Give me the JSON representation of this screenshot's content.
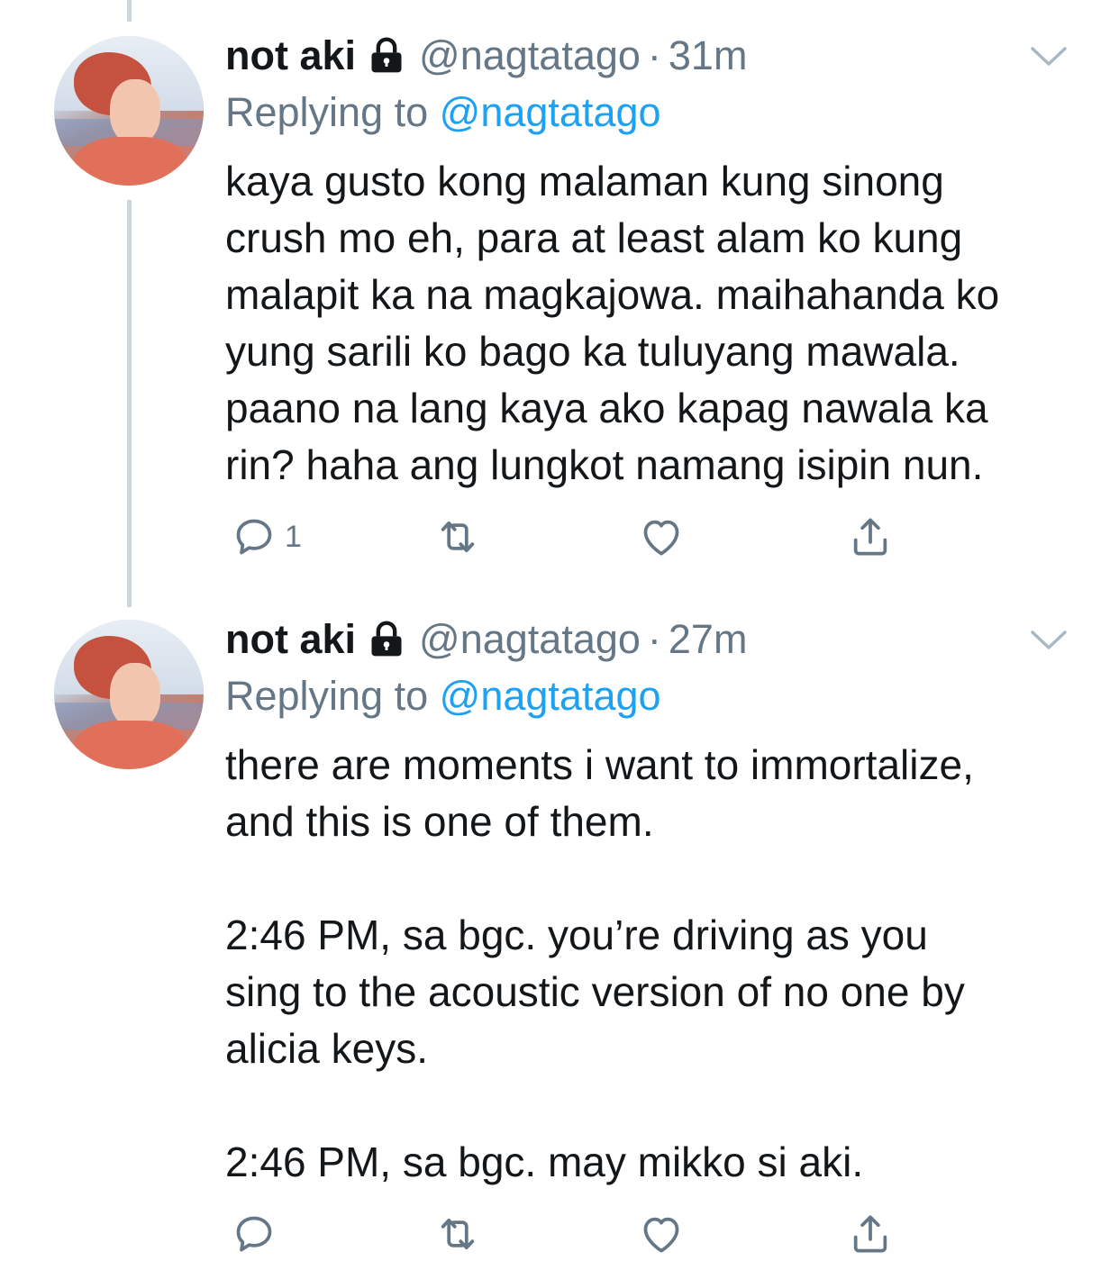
{
  "tweets": [
    {
      "name": "not aki",
      "handle": "@nagtatago",
      "time": "31m",
      "replying_prefix": "Replying to",
      "replying_to": "@nagtatago",
      "text_lines": [
        "kaya gusto kong malaman kung sinong",
        "crush mo eh, para at least alam ko kung",
        "malapit ka na magkajowa. maihahanda ko",
        "yung sarili ko bago ka tuluyang mawala.",
        "paano na lang kaya ako kapag nawala ka",
        "rin? haha ang lungkot namang isipin nun."
      ],
      "reply_count": "1"
    },
    {
      "name": "not aki",
      "handle": "@nagtatago",
      "time": "27m",
      "replying_prefix": "Replying to",
      "replying_to": "@nagtatago",
      "para1": [
        "there are moments i want to immortalize,",
        "and this is one of them."
      ],
      "para2": [
        "2:46 PM, sa bgc. you’re driving as you",
        "sing to the acoustic version of no one by",
        "alicia keys."
      ],
      "para3": [
        "2:46 PM, sa bgc. may mikko si aki."
      ],
      "reply_count": ""
    }
  ],
  "separator": "·",
  "icons": {
    "lock": "lock-icon",
    "chevron": "chevron-down-icon",
    "reply": "reply-icon",
    "retweet": "retweet-icon",
    "like": "heart-icon",
    "share": "share-icon"
  },
  "colors": {
    "text": "#14171a",
    "secondary": "#657786",
    "link": "#1da1f2",
    "thread_line": "#ccd6dd"
  }
}
